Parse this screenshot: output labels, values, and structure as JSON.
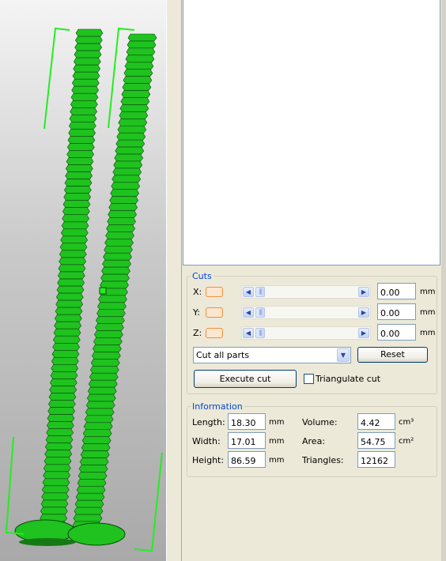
{
  "viewport": {
    "name": "3D model view"
  },
  "cuts": {
    "legend": "Cuts",
    "rows": [
      {
        "axis": "X:",
        "value": "0.00",
        "unit": "mm"
      },
      {
        "axis": "Y:",
        "value": "0.00",
        "unit": "mm"
      },
      {
        "axis": "Z:",
        "value": "0.00",
        "unit": "mm"
      }
    ],
    "mode_select": "Cut all parts",
    "reset_label": "Reset",
    "execute_label": "Execute cut",
    "triangulate_label": "Triangulate cut"
  },
  "info": {
    "legend": "Information",
    "length_label": "Length:",
    "length_value": "18.30",
    "length_unit": "mm",
    "width_label": "Width:",
    "width_value": "17.01",
    "width_unit": "mm",
    "height_label": "Height:",
    "height_value": "86.59",
    "height_unit": "mm",
    "volume_label": "Volume:",
    "volume_value": "4.42",
    "volume_unit": "cm³",
    "area_label": "Area:",
    "area_value": "54.75",
    "area_unit": "cm²",
    "triangles_label": "Triangles:",
    "triangles_value": "12162"
  },
  "colors": {
    "model_green": "#1fc21f",
    "bracket_green": "#22ee22",
    "accent_blue": "#0046d5"
  },
  "icons": {
    "arrow_left": "◀",
    "arrow_right": "▶",
    "dropdown": "▼",
    "thumb": "|||"
  }
}
